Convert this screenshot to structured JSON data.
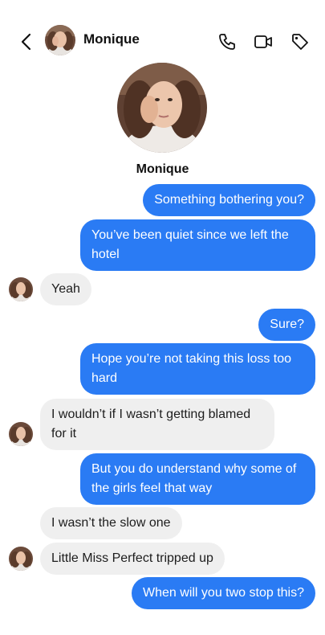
{
  "header": {
    "contact_name": "Monique"
  },
  "profile": {
    "name": "Monique"
  },
  "messages": [
    {
      "dir": "out",
      "text": "Something bothering you?"
    },
    {
      "dir": "out",
      "text": "You’ve been quiet since we left the hotel"
    },
    {
      "dir": "in",
      "text": "Yeah"
    },
    {
      "dir": "out",
      "text": "Sure?"
    },
    {
      "dir": "out",
      "text": "Hope you’re not taking this loss too hard"
    },
    {
      "dir": "in",
      "text": "I wouldn’t if I wasn’t getting blamed for it"
    },
    {
      "dir": "out",
      "text": "But you do understand why some of the girls feel that way"
    },
    {
      "dir": "in",
      "text": "I wasn’t the slow one"
    },
    {
      "dir": "in",
      "text": "Little Miss Perfect tripped up"
    },
    {
      "dir": "out",
      "text": "When will you two stop this?"
    }
  ],
  "icons": {
    "back": "chevron-left-icon",
    "phone": "phone-icon",
    "video": "video-camera-icon",
    "tag": "tag-icon"
  },
  "colors": {
    "outgoing_bubble": "#2a7bf4",
    "incoming_bubble": "#efefef"
  }
}
